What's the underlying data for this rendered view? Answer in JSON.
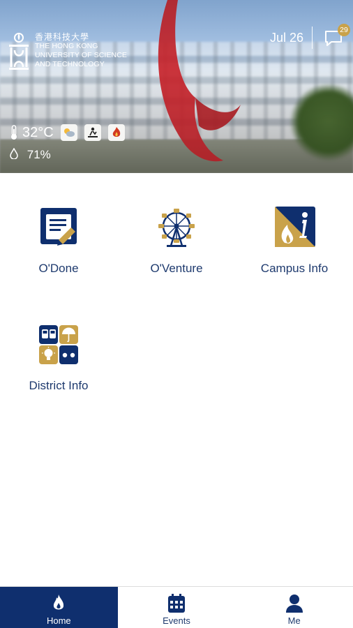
{
  "header": {
    "logo": {
      "name_zh": "香港科技大學",
      "name_en_lines": [
        "THE HONG KONG",
        "UNIVERSITY OF SCIENCE",
        "AND TECHNOLOGY"
      ]
    },
    "date": "Jul 26",
    "messages_badge": "29",
    "weather": {
      "temperature": "32°C",
      "humidity": "71%",
      "icons": [
        "partly-cloudy-icon",
        "uv-index-icon",
        "fire-danger-icon"
      ]
    }
  },
  "apps": [
    {
      "label": "O'Done",
      "icon": "note-edit-icon"
    },
    {
      "label": "O'Venture",
      "icon": "ferris-wheel-icon"
    },
    {
      "label": "Campus Info",
      "icon": "campus-info-icon"
    },
    {
      "label": "District Info",
      "icon": "district-info-icon"
    }
  ],
  "tabs": [
    {
      "label": "Home",
      "icon": "flame-icon",
      "active": true
    },
    {
      "label": "Events",
      "icon": "calendar-icon",
      "active": false
    },
    {
      "label": "Me",
      "icon": "person-icon",
      "active": false
    }
  ],
  "colors": {
    "navy": "#0f2f6e",
    "gold": "#c9a24a",
    "text_blue": "#1e3a6e"
  }
}
